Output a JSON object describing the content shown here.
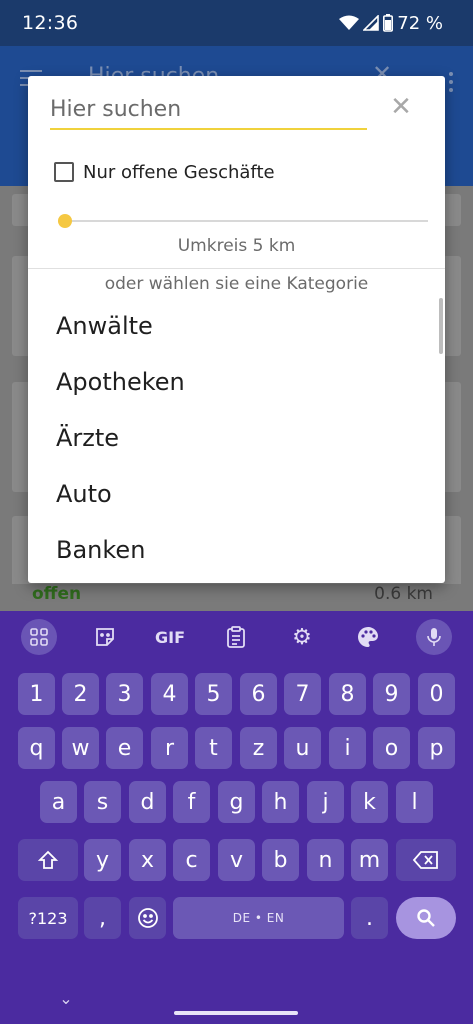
{
  "status": {
    "time": "12:36",
    "battery": "72 %"
  },
  "background": {
    "search_hint": "Hier suchen",
    "result_status": "offen",
    "result_distance": "0.6 km"
  },
  "dialog": {
    "search_placeholder": "Hier suchen",
    "only_open_label": "Nur offene Geschäfte",
    "only_open_checked": false,
    "radius_label": "Umkreis 5 km",
    "category_hint": "oder wählen sie eine Kategorie",
    "categories": [
      "Anwälte",
      "Apotheken",
      "Ärzte",
      "Auto",
      "Banken"
    ]
  },
  "keyboard": {
    "gif_label": "GIF",
    "row_numbers": [
      "1",
      "2",
      "3",
      "4",
      "5",
      "6",
      "7",
      "8",
      "9",
      "0"
    ],
    "row_top": [
      "q",
      "w",
      "e",
      "r",
      "t",
      "z",
      "u",
      "i",
      "o",
      "p"
    ],
    "row_middle": [
      "a",
      "s",
      "d",
      "f",
      "g",
      "h",
      "j",
      "k",
      "l"
    ],
    "row_bottom": [
      "y",
      "x",
      "c",
      "v",
      "b",
      "n",
      "m"
    ],
    "symbols_label": "?123",
    "comma_label": ",",
    "space_label": "DE • EN",
    "period_label": "."
  },
  "colors": {
    "status_bar": "#1b3a6b",
    "keyboard_bg": "#4b2ba0",
    "key_bg": "#6b58b5",
    "accent_yellow": "#f0d23c",
    "offen_green": "#2f6b1d"
  }
}
